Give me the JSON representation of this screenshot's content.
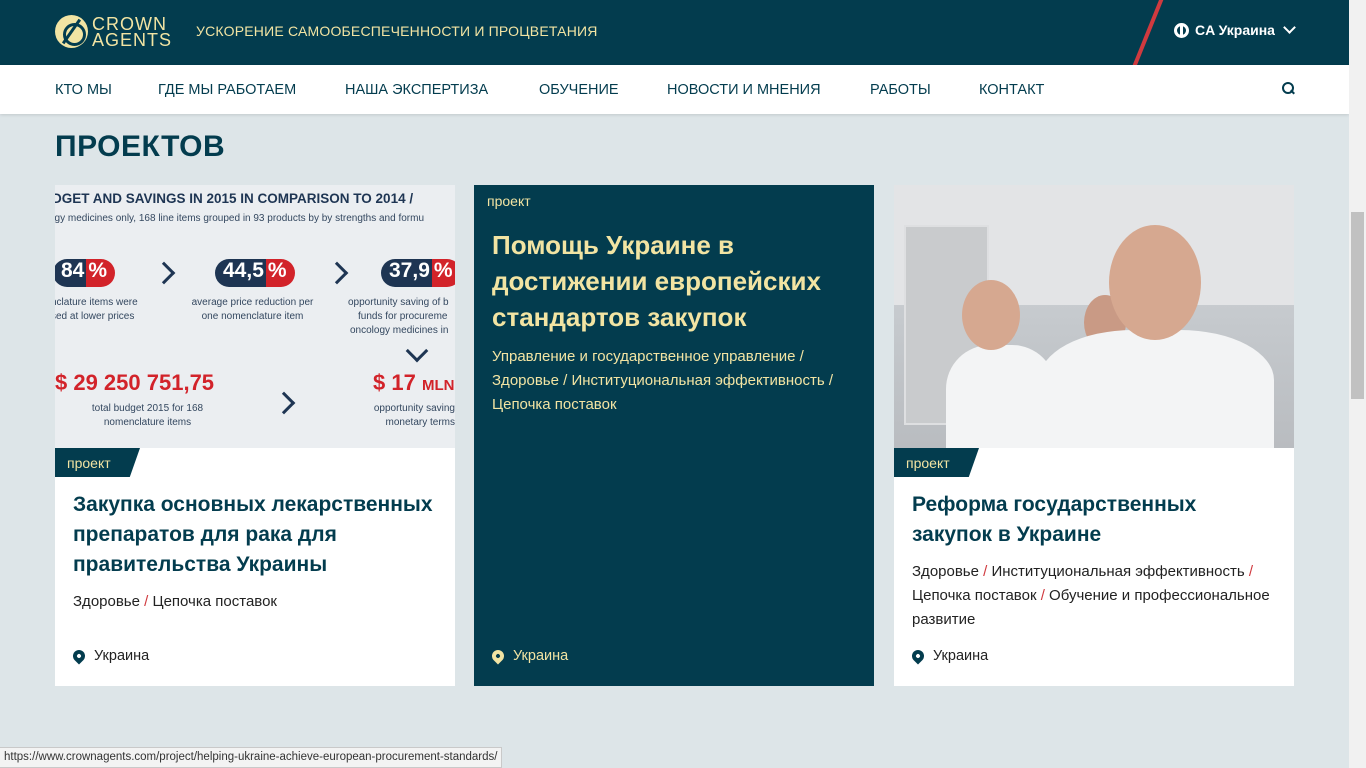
{
  "header": {
    "logo_line1": "CROWN",
    "logo_line2": "AGENTS",
    "tagline": "УСКОРЕНИЕ САМООБЕСПЕЧЕННОСТИ И ПРОЦВЕТАНИЯ",
    "language": "CA Украина"
  },
  "nav": {
    "items": [
      "КТО МЫ",
      "ГДЕ МЫ РАБОТАЕМ",
      "НАША ЭКСПЕРТИЗА",
      "ОБУЧЕНИЕ",
      "НОВОСТИ И МНЕНИЯ",
      "РАБОТЫ",
      "КОНТАКТ"
    ]
  },
  "section": {
    "title": "ПРОЕКТОВ"
  },
  "infographic": {
    "heading": "DGET AND SAVINGS IN 2015 IN COMPARISON TO 2014 /",
    "subheading": "ogy medicines only, 168 line items grouped in 93 products by by strengths and formu",
    "stat1": {
      "a": "84",
      "b": "%",
      "caption1": "nclature items were",
      "caption2": "sed at lower prices"
    },
    "stat2": {
      "a": "44,5",
      "b": "%",
      "caption1": "average price reduction per",
      "caption2": "one nomenclature item"
    },
    "stat3": {
      "a": "37,9",
      "b": "%",
      "caption1": "opportunity saving of b",
      "caption2": "funds for procureme",
      "caption3": "oncology medicines  in"
    },
    "budget": {
      "value": "$ 29 250 751,75",
      "caption1": "total budget 2015 for 168",
      "caption2": "nomenclature items"
    },
    "saving": {
      "value": "$ 17",
      "unit": "MLN",
      "caption1": "opportunity saving",
      "caption2": "monetary terms"
    }
  },
  "cards": [
    {
      "badge": "проект",
      "title": "Закупка основных лекарственных препаратов для рака для правительства Украины",
      "tags": [
        "Здоровье",
        "Цепочка поставок"
      ],
      "location": "Украина"
    },
    {
      "badge": "проект",
      "title": "Помощь Украине в достижении европейских стандартов закупок",
      "tags": [
        "Управление и государственное управление",
        "Здоровье",
        "Институциональная эффективность",
        "Цепочка поставок"
      ],
      "location": "Украина"
    },
    {
      "badge": "проект",
      "title": "Реформа государственных закупок в Украине",
      "tags": [
        "Здоровье",
        "Институциональная эффективность",
        "Цепочка поставок",
        "Обучение и профессиональное развитие"
      ],
      "location": "Украина"
    }
  ],
  "status_url": "https://www.crownagents.com/project/helping-ukraine-achieve-european-procurement-standards/",
  "colors": {
    "primary": "#033c4e",
    "accent": "#f2e4a3",
    "red": "#d03a3f",
    "background": "#dde5e8"
  }
}
